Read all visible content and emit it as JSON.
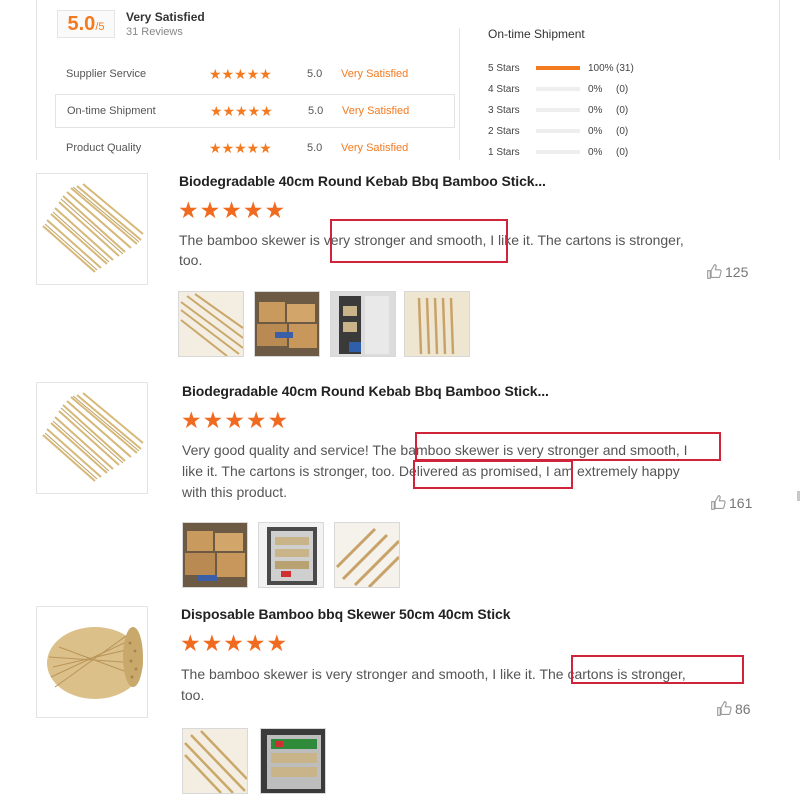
{
  "summary": {
    "score": "5.0",
    "score_max": "/5",
    "satisfaction": "Very Satisfied",
    "reviews_count": "31 Reviews",
    "ratings": [
      {
        "label": "Supplier Service",
        "stars": "★★★★★",
        "value": "5.0",
        "text": "Very Satisfied"
      },
      {
        "label": "On-time Shipment",
        "stars": "★★★★★",
        "value": "5.0",
        "text": "Very Satisfied"
      },
      {
        "label": "Product Quality",
        "stars": "★★★★★",
        "value": "5.0",
        "text": "Very Satisfied"
      }
    ],
    "distribution_title": "On-time Shipment",
    "distribution": [
      {
        "label": "5 Stars",
        "fill": 1.0,
        "percent": "100%",
        "count": "(31)"
      },
      {
        "label": "4 Stars",
        "fill": 0.0,
        "percent": "0%",
        "count": "(0)"
      },
      {
        "label": "3 Stars",
        "fill": 0.0,
        "percent": "0%",
        "count": "(0)"
      },
      {
        "label": "2 Stars",
        "fill": 0.0,
        "percent": "0%",
        "count": "(0)"
      },
      {
        "label": "1 Stars",
        "fill": 0.0,
        "percent": "0%",
        "count": "(0)"
      }
    ]
  },
  "reviews": [
    {
      "title": "Biodegradable 40cm Round Kebab Bbq Bamboo Stick...",
      "stars": "★★★★★",
      "text_line1": "The bamboo skewer is very stronger and smooth, I like it. The cartons is stronger,",
      "text_line2": "too.",
      "likes": "125"
    },
    {
      "title": "Biodegradable 40cm Round Kebab Bbq Bamboo Stick...",
      "stars": "★★★★★",
      "text_line1": "Very good quality and service! The bamboo skewer is very stronger and smooth, I",
      "text_line2": "like it. The cartons is stronger, too. Delivered as promised, I am extremely happy",
      "text_line3": "with this product.",
      "likes": "161"
    },
    {
      "title": "Disposable Bamboo bbq Skewer 50cm 40cm Stick",
      "stars": "★★★★★",
      "text_line1": "The bamboo skewer is very stronger and smooth, I like it. The cartons is stronger,",
      "text_line2": "too.",
      "likes": "86"
    }
  ],
  "colors": {
    "accent": "#f47a20",
    "highlight": "#d0243a"
  }
}
